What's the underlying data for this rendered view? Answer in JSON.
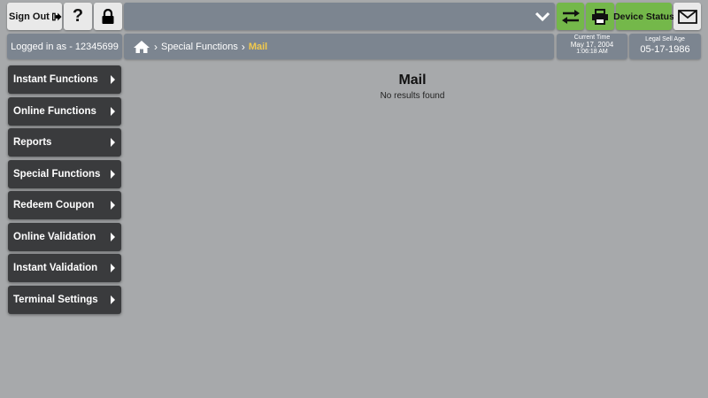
{
  "header": {
    "sign_out_label": "Sign Out",
    "help_label": "?",
    "device_status_label": "Device Status"
  },
  "info": {
    "logged_in": "Logged in as - 12345699",
    "breadcrumb": {
      "home_icon": "home-icon",
      "parent": "Special Functions",
      "current": "Mail"
    },
    "current_time_label": "Current Time",
    "current_date": "May 17, 2004",
    "current_time": "1:06:18 AM",
    "sell_age_label": "Legal Sell Age",
    "sell_age_date": "05-17-1986"
  },
  "sidebar": {
    "items": [
      {
        "label": "Instant Functions"
      },
      {
        "label": "Online Functions"
      },
      {
        "label": "Reports"
      },
      {
        "label": "Special Functions"
      },
      {
        "label": "Redeem Coupon"
      },
      {
        "label": "Online Validation"
      },
      {
        "label": "Instant Validation"
      },
      {
        "label": "Terminal Settings"
      }
    ]
  },
  "main": {
    "title": "Mail",
    "empty_message": "No results found"
  },
  "colors": {
    "background": "#a7a9ab",
    "accent_green": "#74b84a",
    "breadcrumb_current": "#f2c94c",
    "menu_dark": "#3a3b3d",
    "bar_slate": "#7c8590"
  }
}
